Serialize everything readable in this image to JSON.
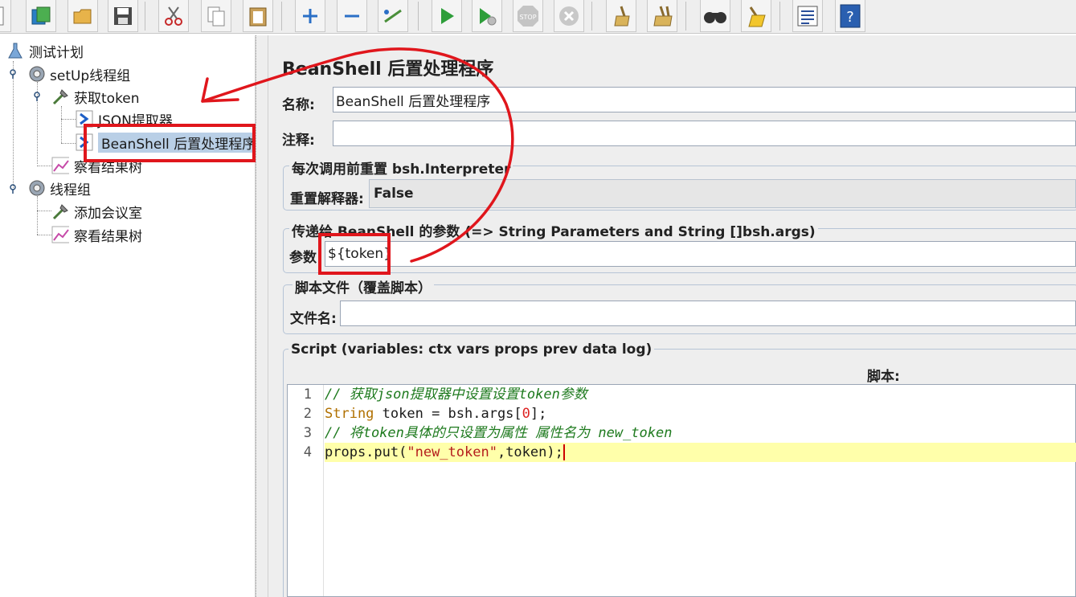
{
  "toolbar": {
    "buttons": [
      {
        "name": "new-icon"
      },
      {
        "name": "templates-icon"
      },
      {
        "name": "open-icon"
      },
      {
        "name": "save-icon"
      },
      {
        "name": "cut-icon"
      },
      {
        "name": "copy-icon"
      },
      {
        "name": "paste-icon"
      },
      {
        "name": "expand-icon"
      },
      {
        "name": "collapse-icon"
      },
      {
        "name": "toggle-icon"
      },
      {
        "name": "start-icon"
      },
      {
        "name": "start-no-pause-icon"
      },
      {
        "name": "stop-icon"
      },
      {
        "name": "shutdown-icon"
      },
      {
        "name": "clear-icon"
      },
      {
        "name": "clear-all-icon"
      },
      {
        "name": "search-icon"
      },
      {
        "name": "reset-search-icon"
      },
      {
        "name": "function-helper-icon"
      },
      {
        "name": "help-icon"
      }
    ],
    "stop_text": "STOP",
    "help_text": "?"
  },
  "tree": {
    "items": [
      {
        "label": "测试计划",
        "icon": "test-plan-icon"
      },
      {
        "label": "setUp线程组",
        "icon": "thread-group-icon"
      },
      {
        "label": "获取token",
        "icon": "sampler-icon"
      },
      {
        "label": "JSON提取器",
        "icon": "post-processor-icon"
      },
      {
        "label": "BeanShell 后置处理程序",
        "icon": "post-processor-icon"
      },
      {
        "label": "察看结果树",
        "icon": "listener-icon"
      },
      {
        "label": "线程组",
        "icon": "thread-group-icon"
      },
      {
        "label": "添加会议室",
        "icon": "sampler-icon"
      },
      {
        "label": "察看结果树",
        "icon": "listener-icon"
      }
    ]
  },
  "panel": {
    "title": "BeanShell 后置处理程序",
    "name_label": "名称:",
    "name_value": "BeanShell 后置处理程序",
    "comment_label": "注释:",
    "comment_value": "",
    "reset_group_title": "每次调用前重置 bsh.Interpreter",
    "reset_label": "重置解释器:",
    "reset_value": "False",
    "params_group_title": "传递给 BeanShell 的参数 (=> String Parameters and String []bsh.args)",
    "params_label": "参数",
    "params_value": "${token}",
    "file_group_title": "脚本文件（覆盖脚本）",
    "file_label": "文件名:",
    "file_value": "",
    "script_group_title": "Script (variables: ctx vars props prev data log)",
    "script_label": "脚本:"
  },
  "script": {
    "line_numbers": [
      "1",
      "2",
      "3",
      "4"
    ],
    "line1": "// 获取json提取器中设置设置token参数",
    "line2_type": "String",
    "line2_mid": " token = bsh.args[",
    "line2_num": "0",
    "line2_end": "];",
    "line3": "// 将token具体的只设置为属性 属性名为 new_token",
    "line4_start": "props.put(",
    "line4_str": "\"new_token\"",
    "line4_end": ",token);"
  },
  "colors": {
    "annotation": "#e0161c",
    "selection": "#b9cfe6",
    "current_line": "#ffffaa"
  }
}
